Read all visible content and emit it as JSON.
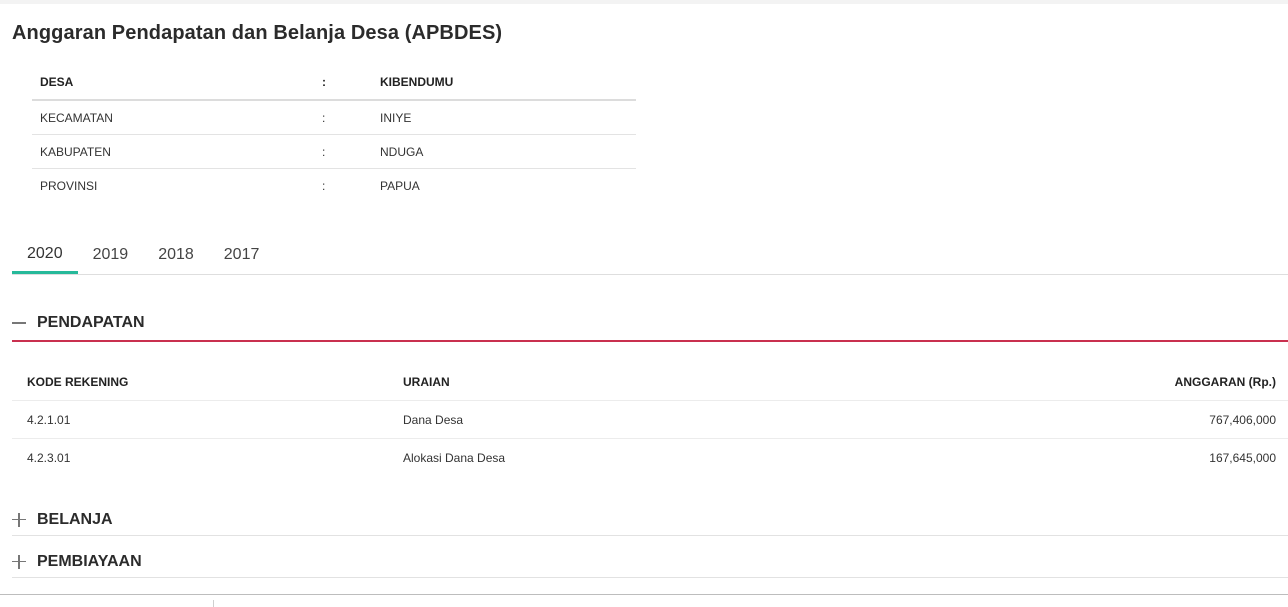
{
  "page": {
    "title": "Anggaran Pendapatan dan Belanja Desa (APBDES)"
  },
  "info": {
    "rows": [
      {
        "label": "DESA",
        "colon": ":",
        "value": "KIBENDUMU"
      },
      {
        "label": "KECAMATAN",
        "colon": ":",
        "value": "INIYE"
      },
      {
        "label": "KABUPATEN",
        "colon": ":",
        "value": "NDUGA"
      },
      {
        "label": "PROVINSI",
        "colon": ":",
        "value": "PAPUA"
      }
    ]
  },
  "tabs": [
    {
      "label": "2020",
      "active": true
    },
    {
      "label": "2019",
      "active": false
    },
    {
      "label": "2018",
      "active": false
    },
    {
      "label": "2017",
      "active": false
    }
  ],
  "sections": {
    "pendapatan": {
      "title": "PENDAPATAN",
      "expanded": true,
      "icon": "minus-icon",
      "columns": {
        "kode": "KODE REKENING",
        "uraian": "URAIAN",
        "anggaran": "ANGGARAN (Rp.)"
      },
      "rows": [
        {
          "kode": "4.2.1.01",
          "uraian": "Dana Desa",
          "anggaran": "767,406,000"
        },
        {
          "kode": "4.2.3.01",
          "uraian": "Alokasi Dana Desa",
          "anggaran": "167,645,000"
        }
      ]
    },
    "belanja": {
      "title": "BELANJA",
      "expanded": false,
      "icon": "plus-icon"
    },
    "pembiayaan": {
      "title": "PEMBIAYAAN",
      "expanded": false,
      "icon": "plus-icon"
    }
  },
  "colors": {
    "tab_active": "#26b99a",
    "pendapatan_underline": "#c9304f"
  }
}
